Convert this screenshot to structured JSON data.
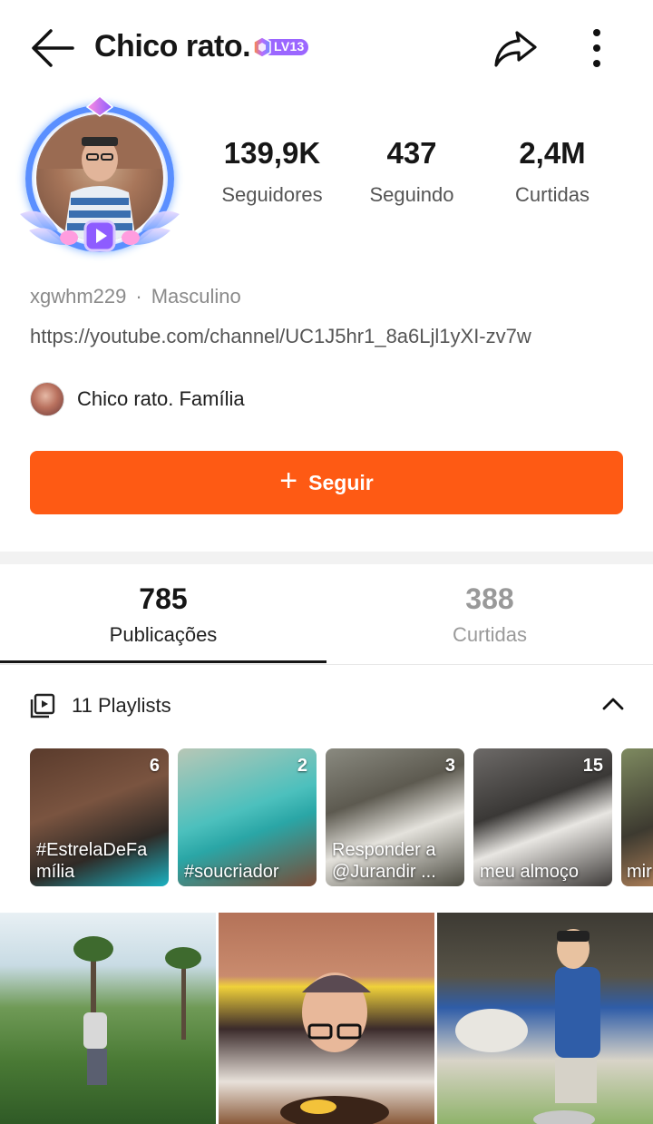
{
  "header": {
    "title": "Chico rato.",
    "level_badge": "LV13"
  },
  "stats": {
    "followers_value": "139,9K",
    "followers_label": "Seguidores",
    "following_value": "437",
    "following_label": "Seguindo",
    "likes_value": "2,4M",
    "likes_label": "Curtidas"
  },
  "profile": {
    "username": "xgwhm229",
    "gender": "Masculino",
    "link": "https://youtube.com/channel/UC1J5hr1_8a6Ljl1yXI-zv7w",
    "family_name": "Chico rato. Família"
  },
  "follow_button": {
    "plus": "+",
    "label": "Seguir"
  },
  "tabs": [
    {
      "count": "785",
      "label": "Publicações",
      "active": true
    },
    {
      "count": "388",
      "label": "Curtidas",
      "active": false
    }
  ],
  "playlists": {
    "header": "11 Playlists",
    "items": [
      {
        "count": "6",
        "name": "#EstrelaDeFa mília"
      },
      {
        "count": "2",
        "name": "#soucriador"
      },
      {
        "count": "3",
        "name": "Responder a @Jurandir ..."
      },
      {
        "count": "15",
        "name": "meu almoço"
      },
      {
        "count": "",
        "name": "mir"
      }
    ]
  },
  "colors": {
    "accent": "#fe5a14",
    "badge": "#a06bff"
  },
  "icons": [
    "back-arrow-icon",
    "share-icon",
    "more-vertical-icon",
    "playlist-icon",
    "chevron-up-icon",
    "plus-icon"
  ]
}
